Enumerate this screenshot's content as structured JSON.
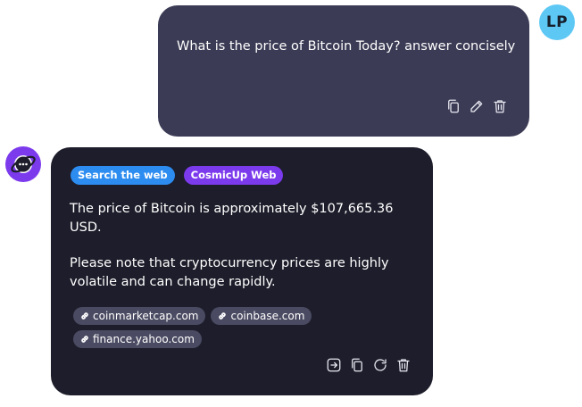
{
  "user_message": {
    "avatar_initials": "LP",
    "text": "What is the price of Bitcoin Today? answer concisely",
    "actions": [
      "copy-icon",
      "edit-icon",
      "trash-icon"
    ]
  },
  "bot_message": {
    "badges": [
      {
        "label": "Search the web",
        "color": "#2d8cf0"
      },
      {
        "label": "CosmicUp Web",
        "color": "#7c3aed"
      }
    ],
    "paragraphs": [
      "The price of Bitcoin is approximately $107,665.36 USD.",
      "Please note that cryptocurrency prices are highly volatile and can change rapidly."
    ],
    "sources": [
      "coinmarketcap.com",
      "coinbase.com",
      "finance.yahoo.com"
    ],
    "actions": [
      "export-icon",
      "copy-icon",
      "regenerate-icon",
      "trash-icon"
    ]
  },
  "colors": {
    "user_bubble": "#3b3b55",
    "bot_bubble": "#1d1d2b",
    "user_avatar": "#5ec8f5",
    "bot_avatar": "#7c3aed",
    "source_chip": "#4a4a62"
  }
}
